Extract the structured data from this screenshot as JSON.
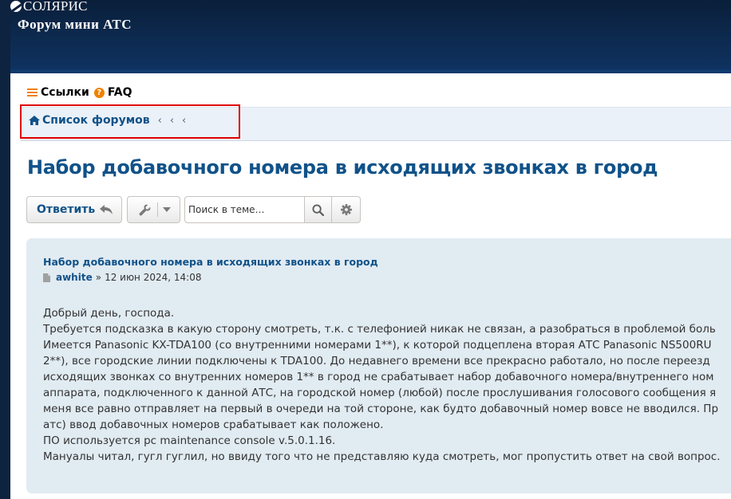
{
  "header": {
    "logo_text": "СОЛЯРИС",
    "site_title": "Форум мини АТС"
  },
  "quicklinks": {
    "links_label": "Ссылки",
    "faq_label": "FAQ",
    "faq_icon": "?"
  },
  "breadcrumbs": {
    "home_label": "Список форумов",
    "separators": [
      "‹",
      "‹",
      "‹"
    ]
  },
  "topic": {
    "title": "Набор добавочного номера в исходящих звонках в город"
  },
  "actions": {
    "reply_label": "Ответить",
    "search_placeholder": "Поиск в теме…"
  },
  "post": {
    "subject": "Набор добавочного номера в исходящих звонках в город",
    "author": "awhite",
    "separator": "»",
    "date": "12 июн 2024, 14:08",
    "lines": [
      "Добрый день, господа.",
      "Требуется подсказка в какую сторону смотреть, т.к. с телефонией никак не связан, а разобраться в проблемой боль",
      "Имеется Panasonic KX-TDA100 (со внутренними номерами 1**), к которой подцеплена вторая АТС Panasonic NS500RU",
      "2**), все городские линии подключены к TDA100. До недавнего времени все прекрасно работало, но после переезд",
      "исходящих звонках со внутренних номеров 1** в город не срабатывает набор добавочного номера/внутреннего ном",
      "аппарата, подключенного к данной АТС, на городской номер (любой) после прослушивания голосового сообщения я",
      "меня все равно отправляет на первый в очереди на той стороне, как будто добавочный номер вовсе не вводился. Пр",
      "атс) ввод добавочных номеров срабатывает как положено.",
      "ПО используется pc maintenance console v.5.0.1.16.",
      "Мануалы читал, гугл гуглил, но ввиду того что не представляю куда смотреть, мог пропустить ответ на свой вопрос."
    ]
  },
  "colors": {
    "header_bg": "#0a1f3a",
    "link_blue": "#105289",
    "accent_orange": "#f08000",
    "post_bg": "#e1ebf2",
    "highlight_red": "#e00000"
  },
  "icons": [
    "hamburger-icon",
    "question-icon",
    "home-icon",
    "reply-arrow-icon",
    "wrench-icon",
    "chevron-down-icon",
    "search-icon",
    "gear-icon",
    "document-icon"
  ]
}
